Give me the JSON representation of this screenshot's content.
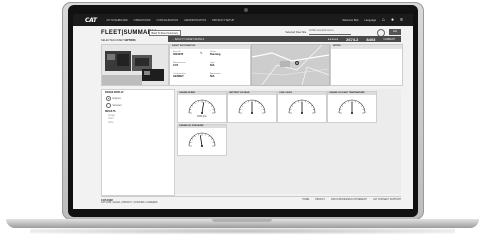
{
  "app": {
    "logo": "CAT",
    "nav": [
      "MY DASHBOARD",
      "OPERATIONS",
      "CONFIGURATION",
      "ADMINISTRATION",
      "PRODUCT SETUP"
    ],
    "user": "Welcome Bob",
    "language": "Language"
  },
  "page": {
    "title": "FLEET|SUMMARY",
    "fleet_button": "Back To Fleet Summary",
    "search_label": "Selected Fleet Site",
    "search_value": "ACME Caterpillar Demo",
    "go_label": "GO",
    "asset_label": "SELECTED ASSET",
    "asset_value": "GRT0001",
    "back_label": "← BACK TO ASSET DETAILS"
  },
  "stats": {
    "stars": "★★★★★",
    "value1": "2674.2",
    "value2": "8403",
    "status": "CURRENT"
  },
  "asset_info": {
    "header": "ASSET INFORMATION",
    "fields": [
      {
        "label": "Asset ID",
        "value": "3604278"
      },
      {
        "label": "Status",
        "value": "Running"
      },
      {
        "label": "Manufacturer",
        "value": "CAT"
      },
      {
        "label": "Type",
        "value": "N/A"
      },
      {
        "label": "Configuration",
        "value": "GENSET"
      },
      {
        "label": "Application",
        "value": "N/A"
      }
    ]
  },
  "notes": {
    "header": "NOTES"
  },
  "sidebar": {
    "range_title": "RANGE DISPLAY",
    "options": [
      "Engines",
      "Selected"
    ],
    "results_title": "RESULTS",
    "results": [
      "Gauge",
      "Chart",
      "Table"
    ]
  },
  "gauges": [
    {
      "title": "ENGINE SPEED",
      "value": "1800 rpm",
      "needle": 0.55
    },
    {
      "title": "BATTERY VOLTAGE",
      "value": "",
      "needle": 0.5
    },
    {
      "title": "FUEL LEVEL",
      "value": "",
      "needle": 0.5
    },
    {
      "title": "ENGINE COOLANT TEMPERATURE",
      "value": "",
      "needle": 0.5
    },
    {
      "title": "ENGINE OIL PRESSURE",
      "value": "",
      "needle": 0.45
    }
  ],
  "footer": {
    "title": "CAT.COM",
    "links": "CAT.COM | LEGAL | PRIVACY | COOKIES | CAREERS",
    "right": [
      "HOME",
      "PRIVACY",
      "DATA PROCESSING STATEMENT",
      "CAT CONNECT SUPPORT"
    ]
  }
}
